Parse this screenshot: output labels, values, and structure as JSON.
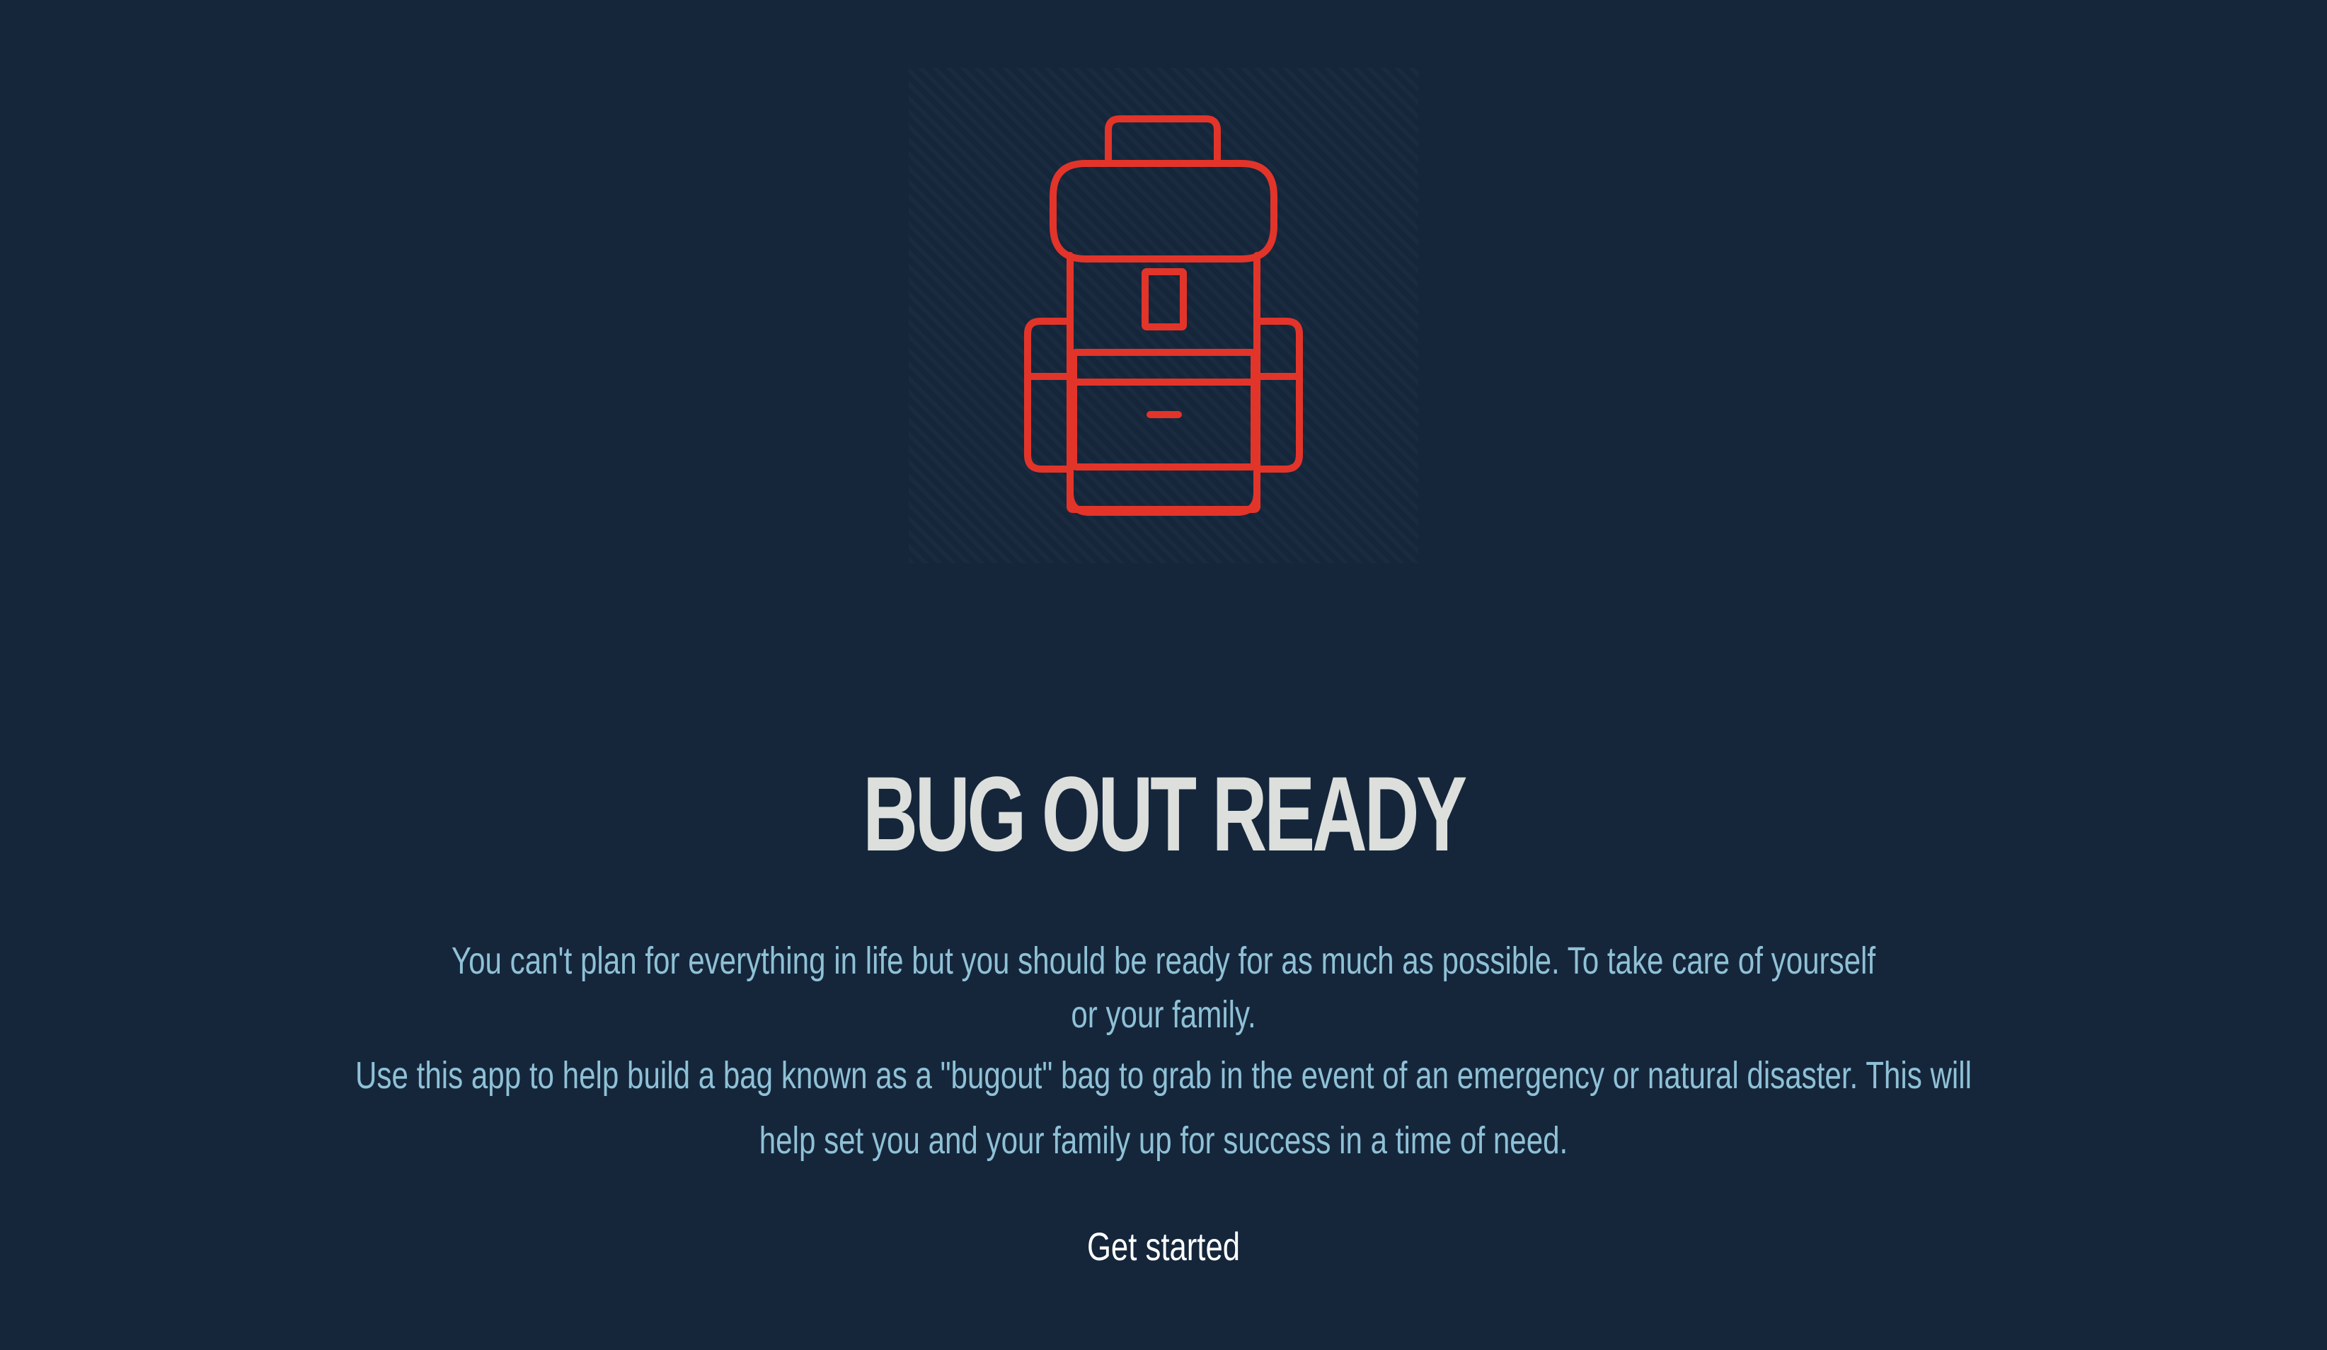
{
  "app": {
    "title": "BUG OUT READY",
    "intro": "You can't plan for everything in life but you should be ready for as much as possible. To take care of yourself or your family.",
    "description": "Use this app to help build a bag known as a \"bugout\" bag to grab in the event of an emergency or natural disaster. This will help set you and your family up for success in a time of need.",
    "cta_label": "Get started"
  },
  "logo": {
    "icon": "backpack-icon"
  },
  "colors": {
    "background": "#15263b",
    "accent": "#e3342a",
    "title": "#dcdfdc",
    "body_text": "#8fc1d6",
    "cta_text": "#ffffff"
  }
}
